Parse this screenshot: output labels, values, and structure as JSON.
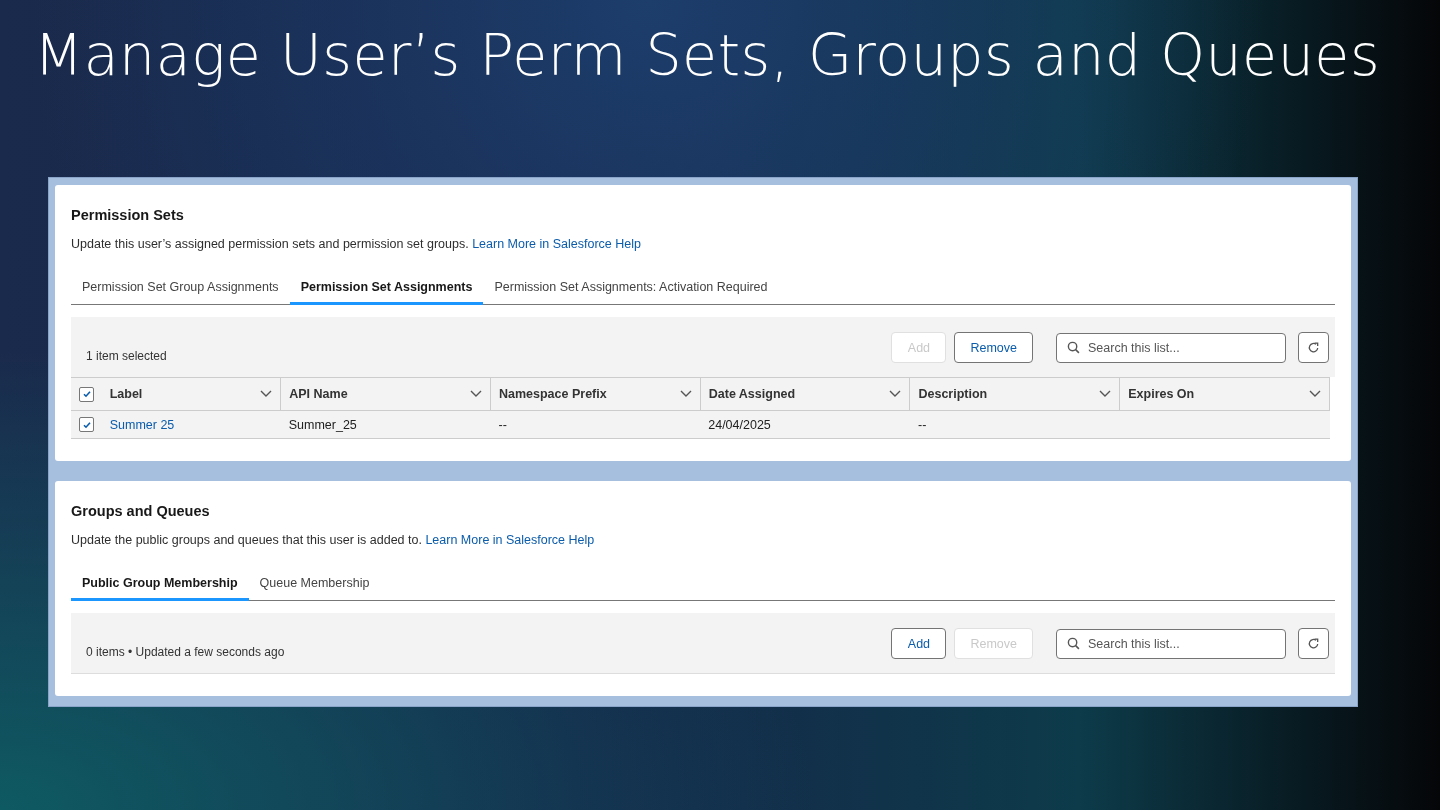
{
  "slide": {
    "title": "Manage User’s Perm Sets, Groups and Queues"
  },
  "panels": [
    {
      "title": "Permission Sets",
      "description": "Update this user’s assigned permission sets and permission set groups.",
      "link": "Learn More in Salesforce Help",
      "tabs": [
        {
          "label": "Permission Set Group Assignments",
          "selected": false
        },
        {
          "label": "Permission Set Assignments",
          "selected": true
        },
        {
          "label": "Permission Set Assignments: Activation Required",
          "selected": false
        }
      ],
      "toolbar": {
        "status": "1 item selected",
        "buttons": [
          {
            "label": "Add",
            "disabled": true
          },
          {
            "label": "Remove",
            "disabled": false
          }
        ],
        "search": {
          "placeholder": "Search this list..."
        }
      },
      "table": {
        "select_all_checked": true,
        "columns": [
          "Label",
          "API Name",
          "Namespace Prefix",
          "Date Assigned",
          "Description",
          "Expires On"
        ],
        "rows": [
          {
            "checked": true,
            "cells": [
              "Summer 25",
              "Summer_25",
              "--",
              "24/04/2025",
              "--"
            ]
          }
        ]
      }
    },
    {
      "title": "Groups and Queues",
      "description": "Update the public groups and queues that this user is added to.",
      "link": "Learn More in Salesforce Help",
      "tabs": [
        {
          "label": "Public Group Membership",
          "selected": true
        },
        {
          "label": "Queue Membership",
          "selected": false
        }
      ],
      "toolbar": {
        "status": "0 items • Updated a few seconds ago",
        "buttons": [
          {
            "label": "Add",
            "disabled": false
          },
          {
            "label": "Remove",
            "disabled": true
          }
        ],
        "search": {
          "placeholder": "Search this list..."
        }
      }
    }
  ]
}
